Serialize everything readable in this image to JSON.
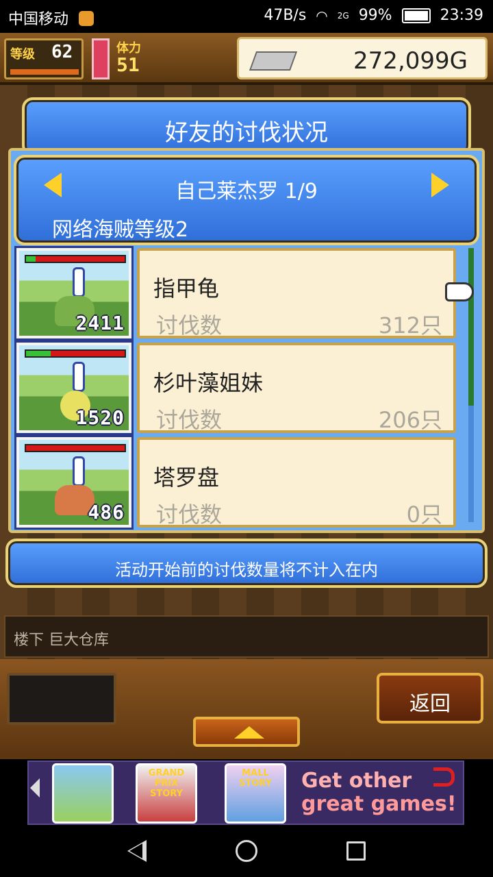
{
  "status_bar": {
    "carrier": "中国移动",
    "net_speed": "47B/s",
    "network": "2G",
    "battery": "99%",
    "time": "23:39"
  },
  "top_bar": {
    "level_label": "等级",
    "level_value": "62",
    "stamina_label": "体力",
    "stamina_value": "51",
    "gold": "272,099G"
  },
  "dialog": {
    "title": "好友的讨伐状况",
    "friend_name": "自己莱杰罗 1/9",
    "pirate_level": "网络海贼等级2",
    "entries": [
      {
        "name": "指甲龟",
        "count_label": "讨伐数",
        "count": "312只",
        "thumb_number": "2411",
        "hp_fraction": 0.1
      },
      {
        "name": "杉叶藻姐妹",
        "count_label": "讨伐数",
        "count": "206只",
        "thumb_number": "1520",
        "hp_fraction": 0.25
      },
      {
        "name": "塔罗盘",
        "count_label": "讨伐数",
        "count": "0只",
        "thumb_number": "486",
        "hp_fraction": 0
      }
    ],
    "notice": "活动开始前的讨伐数量将不计入在内"
  },
  "location": "楼下 巨大仓库",
  "buttons": {
    "back": "返回"
  },
  "ads": {
    "tiles": [
      "",
      "GRAND PRIX STORY",
      "MALL STORY"
    ],
    "tagline_1": "Get other",
    "tagline_2": "great games!"
  },
  "colors": {
    "panel_blue": "#2f6ed8",
    "card_bg": "#fbf0d4",
    "gold_text": "#ffd24a",
    "hp_red": "#d41818",
    "hp_green": "#38c038"
  }
}
